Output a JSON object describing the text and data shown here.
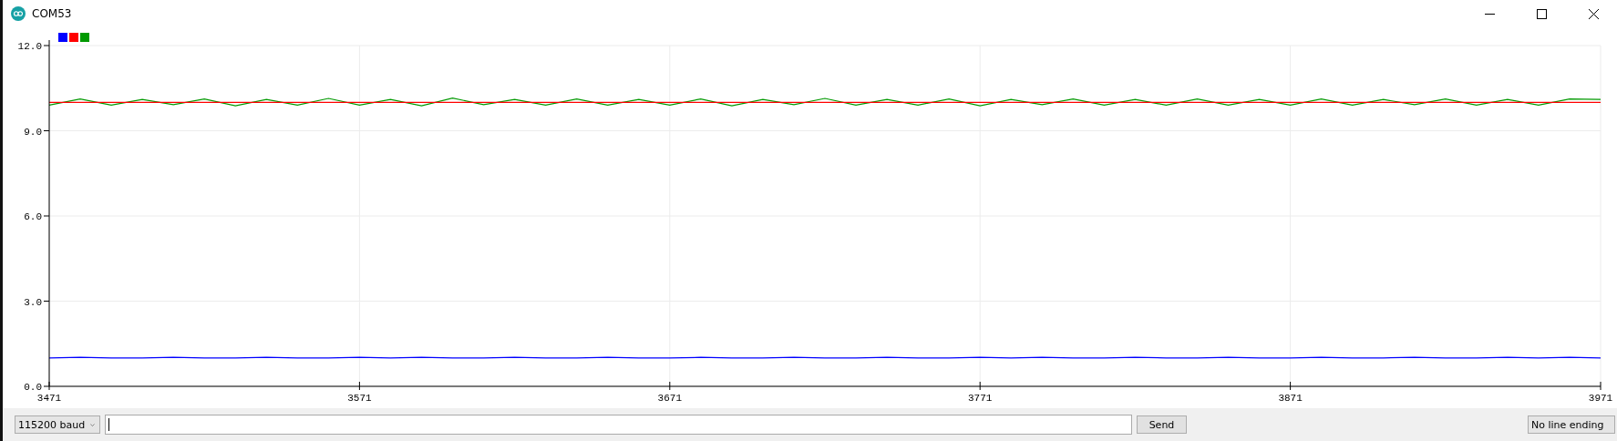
{
  "window": {
    "title": "COM53"
  },
  "plot": {
    "chart_data": {
      "type": "line",
      "x": [
        3471,
        3481,
        3491,
        3501,
        3511,
        3521,
        3531,
        3541,
        3551,
        3561,
        3571,
        3581,
        3591,
        3601,
        3611,
        3621,
        3631,
        3641,
        3651,
        3661,
        3671,
        3681,
        3691,
        3701,
        3711,
        3721,
        3731,
        3741,
        3751,
        3761,
        3771,
        3781,
        3791,
        3801,
        3811,
        3821,
        3831,
        3841,
        3851,
        3861,
        3871,
        3881,
        3891,
        3901,
        3911,
        3921,
        3931,
        3941,
        3951,
        3961,
        3971
      ],
      "series": [
        {
          "color": "#0000ff",
          "values": [
            1.0,
            1.02,
            1.0,
            1.0,
            1.02,
            1.0,
            1.0,
            1.02,
            1.0,
            1.0,
            1.02,
            1.0,
            1.02,
            1.0,
            1.0,
            1.02,
            1.0,
            1.0,
            1.02,
            1.0,
            1.0,
            1.02,
            1.0,
            1.0,
            1.02,
            1.0,
            1.0,
            1.02,
            1.0,
            1.0,
            1.02,
            1.0,
            1.02,
            1.0,
            1.0,
            1.02,
            1.0,
            1.0,
            1.02,
            1.0,
            1.0,
            1.02,
            1.0,
            1.0,
            1.02,
            1.0,
            1.0,
            1.02,
            1.0,
            1.02,
            1.0
          ]
        },
        {
          "color": "#ff0000",
          "values": [
            10.0,
            10.0,
            10.0,
            10.0,
            10.0,
            10.0,
            10.0,
            10.0,
            10.0,
            10.0,
            10.0,
            10.0,
            10.0,
            10.0,
            10.0,
            10.0,
            10.0,
            10.0,
            10.0,
            10.0,
            10.0,
            10.0,
            10.0,
            10.0,
            10.0,
            10.0,
            10.0,
            10.0,
            10.0,
            10.0,
            10.0,
            10.0,
            10.0,
            10.0,
            10.0,
            10.0,
            10.0,
            10.0,
            10.0,
            10.0,
            10.0,
            10.0,
            10.0,
            10.0,
            10.0,
            10.0,
            10.0,
            10.0,
            10.0,
            10.0,
            10.0
          ]
        },
        {
          "color": "#009900",
          "values": [
            9.9,
            10.12,
            9.9,
            10.1,
            9.92,
            10.12,
            9.88,
            10.1,
            9.9,
            10.14,
            9.9,
            10.1,
            9.88,
            10.15,
            9.92,
            10.1,
            9.9,
            10.12,
            9.9,
            10.1,
            9.9,
            10.12,
            9.88,
            10.1,
            9.92,
            10.14,
            9.9,
            10.1,
            9.9,
            10.12,
            9.88,
            10.1,
            9.92,
            10.12,
            9.9,
            10.1,
            9.9,
            10.12,
            9.9,
            10.1,
            9.9,
            10.12,
            9.9,
            10.1,
            9.92,
            10.12,
            9.9,
            10.1,
            9.9,
            10.12,
            10.1
          ]
        }
      ],
      "grid": true,
      "xlim": [
        3471,
        3971
      ],
      "ylim": [
        0,
        12
      ],
      "xticks": [
        3471,
        3571,
        3671,
        3771,
        3871,
        3971
      ],
      "yticks": [
        {
          "value": 0,
          "label": "0.0"
        },
        {
          "value": 3,
          "label": "3.0"
        },
        {
          "value": 6,
          "label": "6.0"
        },
        {
          "value": 9,
          "label": "9.0"
        },
        {
          "value": 12,
          "label": "12.0"
        }
      ]
    }
  },
  "controls": {
    "baud": "115200 baud",
    "send_button": "Send",
    "line_ending": "No line ending"
  }
}
